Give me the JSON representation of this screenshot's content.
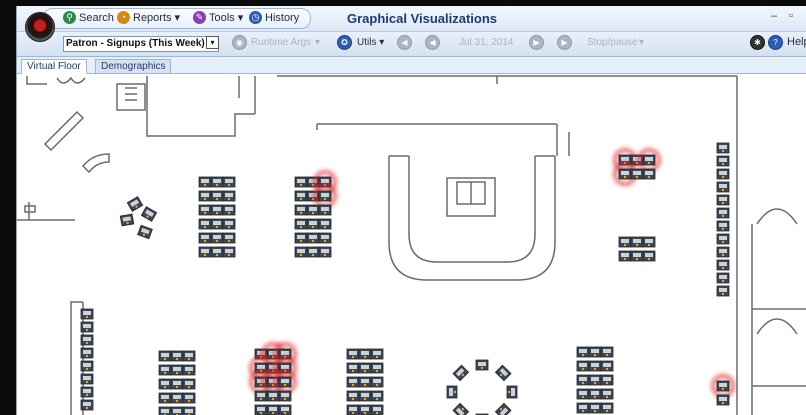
{
  "window": {
    "title": "Graphical Visualizations",
    "minimize": "–",
    "restore": "▫"
  },
  "menu": {
    "search": "Search",
    "reports": "Reports",
    "tools": "Tools",
    "history": "History",
    "caret": "▾"
  },
  "toolbar": {
    "report_select": "Patron - Signups (This Week)",
    "runtime_args": "Runtime Args",
    "utils": "Utils",
    "date": "Jul 31, 2014",
    "stop_label": "Stop/pause",
    "help": "Help"
  },
  "tabs": [
    {
      "label": "Virtual Floor",
      "active": true
    },
    {
      "label": "Demographics",
      "active": false
    }
  ],
  "floor": {
    "machine_color": "#3e4650",
    "highlight_color": "#e02020",
    "wall_color": "#6b6b6b"
  }
}
